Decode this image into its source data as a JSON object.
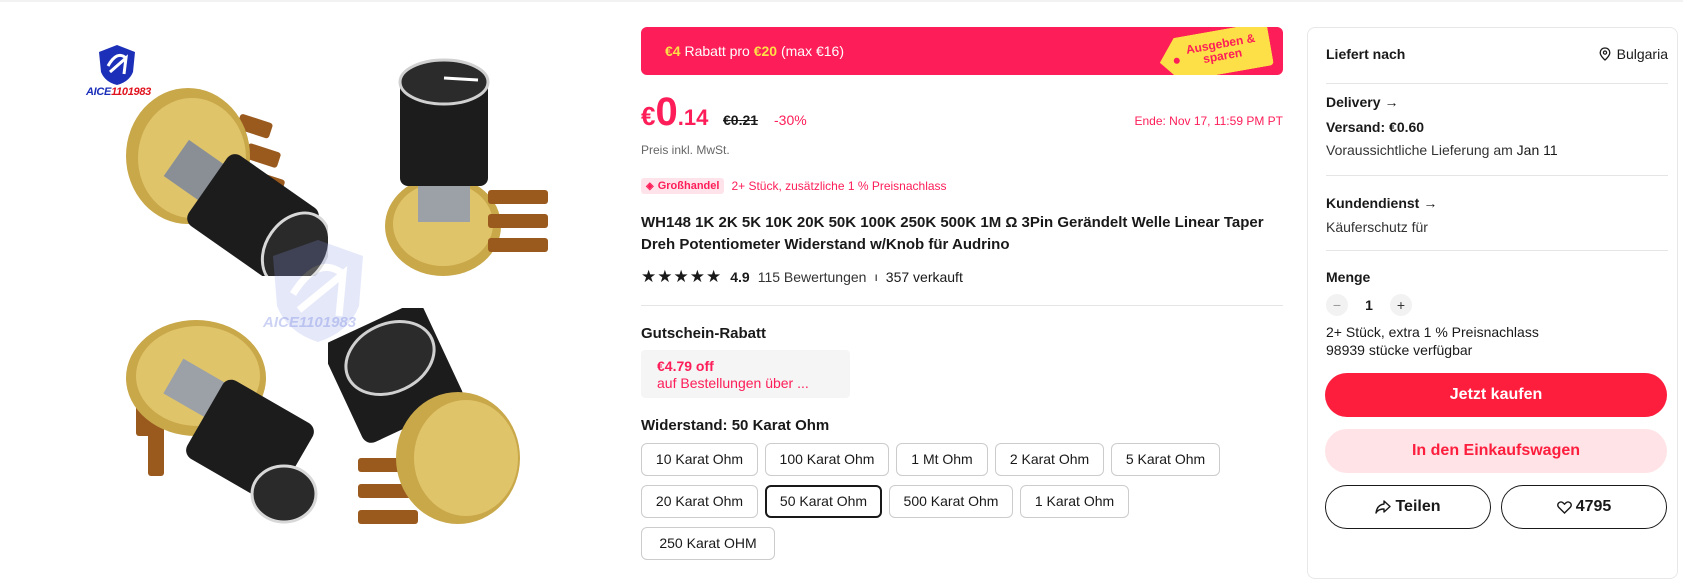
{
  "brand": {
    "logo_text_a": "A",
    "logo_text_b": "ICE",
    "logo_text_c": "1101983",
    "watermark_text": "AICE1101983"
  },
  "promo": {
    "discount": "€4",
    "text_mid": "Rabatt pro",
    "threshold": "€20",
    "max": "(max €16)",
    "tag_line1": "Ausgeben &",
    "tag_line2": "sparen"
  },
  "price": {
    "currency": "€",
    "integer": "0",
    "decimal": ".14",
    "original": "€0.21",
    "discount": "-30%",
    "end": "Ende: Nov 17, 11:59 PM PT",
    "tax_note": "Preis inkl. MwSt."
  },
  "wholesale": {
    "badge": "Großhandel",
    "text": "2+ Stück, zusätzliche 1 % Preisnachlass"
  },
  "product": {
    "title": "WH148 1K 2K 5K 10K 20K 50K 100K 250K 500K 1M Ω 3Pin Gerändelt Welle Linear Taper Dreh Potentiometer Widerstand w/Knob für Audrino",
    "rating": "4.9",
    "stars": 5,
    "reviews": "115 Bewertungen",
    "separator": "ı",
    "sold": "357 verkauft"
  },
  "coupon": {
    "label": "Gutschein-Rabatt",
    "amount": "€4.79 off",
    "condition": "auf Bestellungen über ..."
  },
  "variants": {
    "label": "Widerstand:",
    "selected_value": "50 Karat Ohm",
    "options": [
      "10 Karat Ohm",
      "100 Karat Ohm",
      "1 Mt Ohm",
      "2 Karat Ohm",
      "5 Karat Ohm",
      "20 Karat Ohm",
      "50 Karat Ohm",
      "500 Karat Ohm",
      "1 Karat Ohm",
      "250 Karat OHM"
    ]
  },
  "panel": {
    "ship_label": "Liefert nach",
    "ship_country": "Bulgaria",
    "delivery_title": "Delivery",
    "shipping_cost": "Versand: €0.60",
    "eta_text": "Voraussichtliche Lieferung am",
    "eta_date": "Jan 11",
    "service_title": "Kundendienst",
    "service_text": "Käuferschutz für",
    "qty_label": "Menge",
    "qty_minus": "−",
    "qty_value": "1",
    "qty_plus": "+",
    "qty_note": "2+ Stück, extra 1 % Preisnachlass",
    "stock": "98939 stücke verfügbar",
    "buy_now": "Jetzt kaufen",
    "add_to_cart": "In den Einkaufswagen",
    "share": "Teilen",
    "wishlist_count": "4795"
  },
  "colors": {
    "accent": "#fd1d58",
    "buy": "#fd1d3d",
    "promo_yellow": "#fde047",
    "brand_blue": "#1b2fb8"
  }
}
